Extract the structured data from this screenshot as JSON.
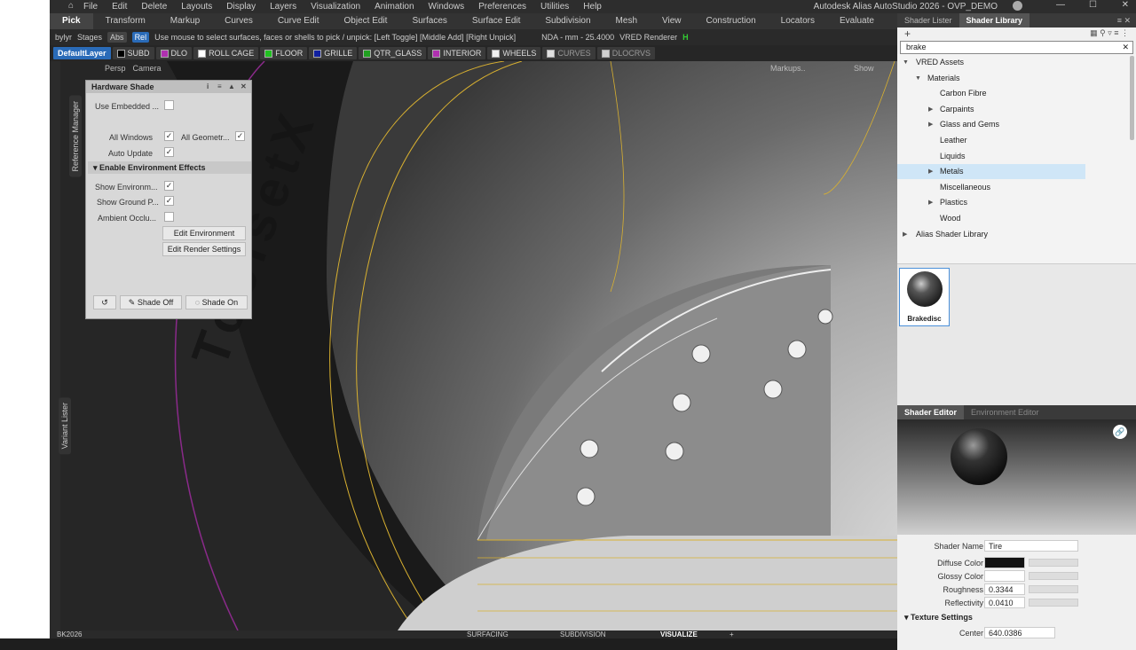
{
  "menu": {
    "items": [
      "File",
      "Edit",
      "Delete",
      "Layouts",
      "Display",
      "Layers",
      "Visualization",
      "Animation",
      "Windows",
      "Preferences",
      "Utilities",
      "Help"
    ],
    "app_title": "Autodesk Alias AutoStudio 2026  -  OVP_DEMO"
  },
  "palette_tabs": [
    "Pick",
    "Transform",
    "Markup",
    "Curves",
    "Curve Edit",
    "Object Edit",
    "Surfaces",
    "Surface Edit",
    "Subdivision",
    "Mesh",
    "View",
    "Construction",
    "Locators",
    "Evaluate"
  ],
  "status": {
    "bylyr": "bylyr",
    "stages": "Stages",
    "abs": "Abs",
    "rel": "Rel",
    "prompt": "Use mouse to select surfaces, faces or shells to pick / unpick: [Left Toggle] [Middle Add] [Right Unpick]",
    "units": "NDA  -  mm  -  25.4000",
    "renderer": "VRED Renderer"
  },
  "layers": [
    {
      "name": "DefaultLayer",
      "color": "#2a6bb8"
    },
    {
      "name": "SUBD",
      "color": "#000000"
    },
    {
      "name": "DLO",
      "color": "#b030b0"
    },
    {
      "name": "ROLL CAGE",
      "color": "#ffffff"
    },
    {
      "name": "FLOOR",
      "color": "#20c020"
    },
    {
      "name": "GRILLE",
      "color": "#1020a0"
    },
    {
      "name": "QTR_GLASS",
      "color": "#20a020"
    },
    {
      "name": "INTERIOR",
      "color": "#b030b0"
    },
    {
      "name": "WHEELS",
      "color": "#f0f0f0"
    },
    {
      "name": "CURVES",
      "color": "#e0e0e0"
    },
    {
      "name": "DLOCRVS",
      "color": "#d0d0d0"
    }
  ],
  "viewport": {
    "persp": "Persp",
    "camera": "Camera",
    "markups": "Markups..",
    "show": "Show",
    "tire_text": "ToolsetX"
  },
  "side_tabs": {
    "reference": "Reference Manager",
    "variant": "Variant Lister"
  },
  "hw_shade": {
    "title": "Hardware Shade",
    "use_embedded": "Use Embedded ...",
    "all_windows": "All Windows",
    "all_geometry": "All Geometr...",
    "auto_update": "Auto Update",
    "section": "Enable Environment Effects",
    "show_env": "Show Environm...",
    "show_ground": "Show Ground P...",
    "ambient": "Ambient Occlu...",
    "edit_env": "Edit Environment",
    "edit_render": "Edit Render Settings",
    "shade_off": "Shade Off",
    "shade_on": "Shade On"
  },
  "shader_panel": {
    "tabs": [
      "Shader Lister",
      "Shader Library"
    ],
    "search": "brake",
    "tree": [
      {
        "label": "VRED Assets",
        "level": 0,
        "arrow": "down"
      },
      {
        "label": "Materials",
        "level": 1,
        "arrow": "down"
      },
      {
        "label": "Carbon Fibre",
        "level": 2,
        "arrow": ""
      },
      {
        "label": "Carpaints",
        "level": 2,
        "arrow": "right"
      },
      {
        "label": "Glass and Gems",
        "level": 2,
        "arrow": "right"
      },
      {
        "label": "Leather",
        "level": 2,
        "arrow": ""
      },
      {
        "label": "Liquids",
        "level": 2,
        "arrow": ""
      },
      {
        "label": "Metals",
        "level": 2,
        "arrow": "right",
        "selected": true
      },
      {
        "label": "Miscellaneous",
        "level": 2,
        "arrow": ""
      },
      {
        "label": "Plastics",
        "level": 2,
        "arrow": "right"
      },
      {
        "label": "Wood",
        "level": 2,
        "arrow": ""
      },
      {
        "label": "Alias Shader Library",
        "level": 0,
        "arrow": "right"
      }
    ],
    "thumb_label": "Brakedisc",
    "editor_tabs": [
      "Shader Editor",
      "Environment Editor"
    ],
    "shader_name_label": "Shader Name",
    "shader_name": "Tire",
    "diffuse_label": "Diffuse Color",
    "glossy_label": "Glossy Color",
    "roughness_label": "Roughness",
    "roughness": "0.3344",
    "reflectivity_label": "Reflectivity",
    "reflectivity": "0.0410",
    "texture_section": "Texture Settings",
    "center_label": "Center",
    "center": "640.0386",
    "colors": {
      "diffuse": "#111111",
      "glossy": "#ffffff"
    }
  },
  "bottom": {
    "file": "BK2026",
    "tabs": [
      "SURFACING",
      "SUBDIVISION",
      "VISUALIZE"
    ]
  }
}
